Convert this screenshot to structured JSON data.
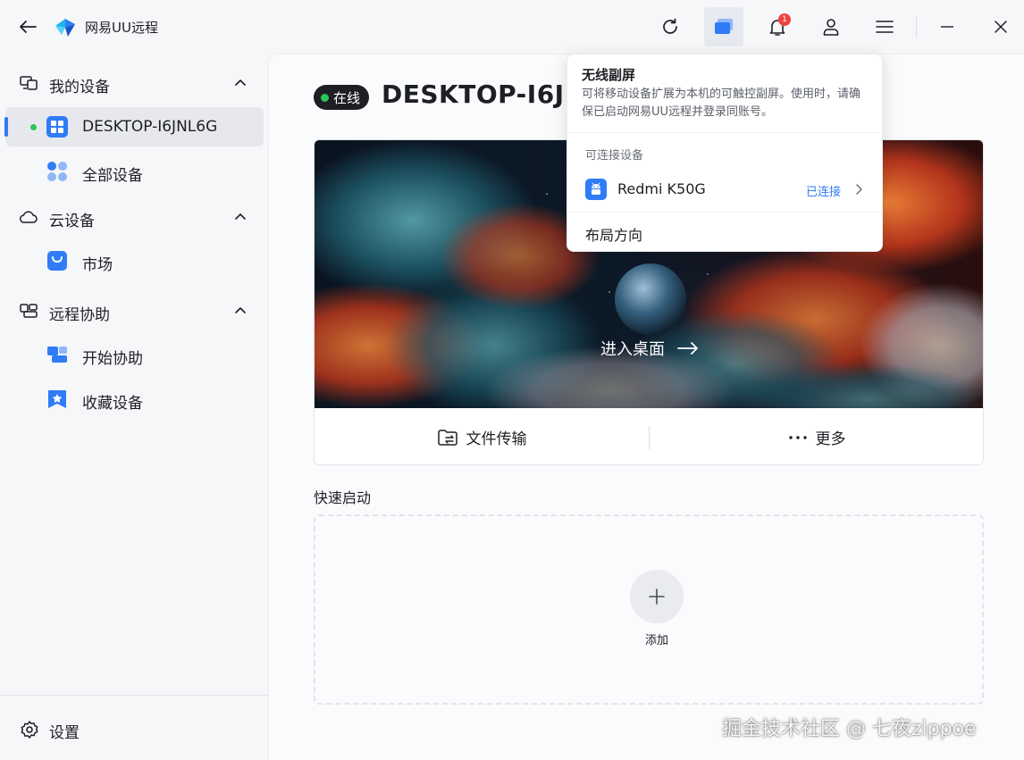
{
  "app": {
    "title": "网易UU远程"
  },
  "titlebar": {
    "notification_count": "1"
  },
  "sidebar": {
    "groups": [
      {
        "label": "我的设备",
        "items": [
          {
            "label": "DESKTOP-I6JNL6G"
          },
          {
            "label": "全部设备"
          }
        ]
      },
      {
        "label": "云设备",
        "items": [
          {
            "label": "市场"
          }
        ]
      },
      {
        "label": "远程协助",
        "items": [
          {
            "label": "开始协助"
          },
          {
            "label": "收藏设备"
          }
        ]
      }
    ],
    "settings_label": "设置"
  },
  "main": {
    "status": "在线",
    "device_title": "DESKTOP-I6JNL6G",
    "enter_desktop": "进入桌面",
    "file_transfer": "文件传输",
    "more": "更多",
    "quick_start_label": "快速启动",
    "add_label": "添加"
  },
  "popup": {
    "title": "无线副屏",
    "description": "可将移动设备扩展为本机的可触控副屏。使用时，请确保已启动网易UU远程并登录同账号。",
    "subheading": "可连接设备",
    "device_name": "Redmi K50G",
    "device_status": "已连接",
    "layout_label": "布局方向"
  },
  "watermark": "掘金技术社区 @ 七夜zippoe",
  "colors": {
    "accent": "#2f7cf6",
    "online": "#2bc45a",
    "badge": "#f04141"
  }
}
